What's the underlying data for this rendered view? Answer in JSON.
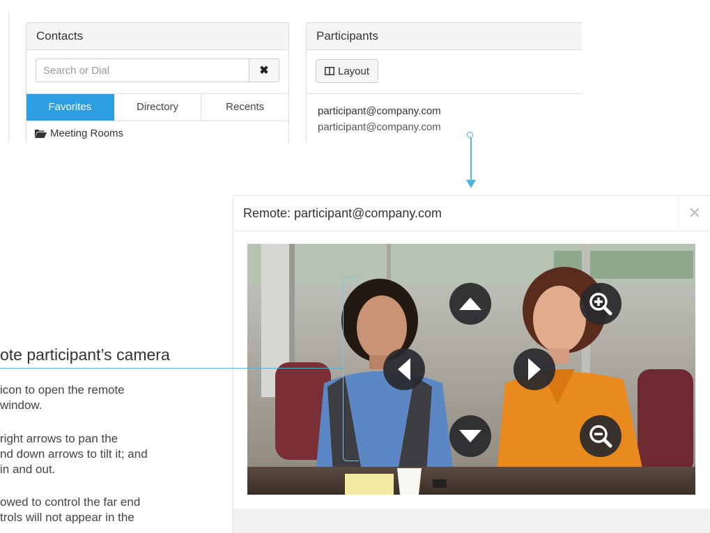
{
  "contacts": {
    "title": "Contacts",
    "search_placeholder": "Search or Dial",
    "tabs": [
      {
        "label": "Favorites",
        "active": true
      },
      {
        "label": "Directory",
        "active": false
      },
      {
        "label": "Recents",
        "active": false
      }
    ],
    "folder_label": "Meeting Rooms"
  },
  "participants": {
    "title": "Participants",
    "layout_label": "Layout",
    "item": {
      "name": "participant@company.com",
      "address": "participant@company.com"
    }
  },
  "dialog": {
    "title": "Remote: participant@company.com",
    "controls": [
      "tilt-up",
      "pan-left",
      "pan-right",
      "tilt-down",
      "zoom-in",
      "zoom-out"
    ]
  },
  "help": {
    "title": "ote participant’s camera",
    "paragraphs": [
      [
        "icon to open the remote",
        "window."
      ],
      [
        "right arrows to pan the",
        "nd down arrows to tilt it; and",
        "in and out."
      ],
      [
        "owed to control the far end",
        "trols will not appear in the"
      ]
    ]
  },
  "colors": {
    "accent": "#2d9ee0",
    "connector": "#4ab5dd",
    "control_bg": "#28282c"
  }
}
